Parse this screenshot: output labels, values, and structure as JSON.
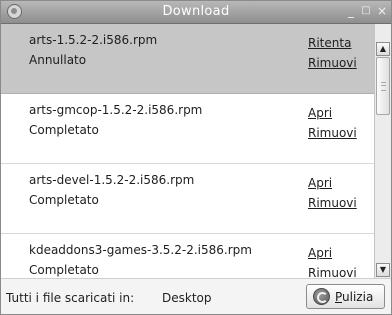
{
  "window": {
    "title": "Download",
    "controls": {
      "minimize": "_",
      "maximize": "□",
      "close": "×"
    }
  },
  "downloads": [
    {
      "filename": "arts-1.5.2-2.i586.rpm",
      "status": "Annullato",
      "action_primary": "Ritenta",
      "action_secondary": "Rimuovi",
      "selected": true
    },
    {
      "filename": "arts-gmcop-1.5.2-2.i586.rpm",
      "status": "Completato",
      "action_primary": "Apri",
      "action_secondary": "Rimuovi",
      "selected": false
    },
    {
      "filename": "arts-devel-1.5.2-2.i586.rpm",
      "status": "Completato",
      "action_primary": "Apri",
      "action_secondary": "Rimuovi",
      "selected": false
    },
    {
      "filename": "kdeaddons3-games-3.5.2-2.i586.rpm",
      "status": "Completato",
      "action_primary": "Apri",
      "action_secondary": "Rimuovi",
      "selected": false
    }
  ],
  "footer": {
    "destination_label": "Tutti i file scaricati in:",
    "destination_value": "Desktop",
    "clean_button": {
      "label": "Pulizia",
      "mnemonic": "P",
      "rest": "ulizia",
      "icon": "clean-icon"
    }
  },
  "scrollbar": {
    "position_fraction": 0.0
  },
  "colors": {
    "titlebar": "#a3a3a3",
    "selected_row": "#c6c6c6",
    "background": "#ffffff"
  }
}
